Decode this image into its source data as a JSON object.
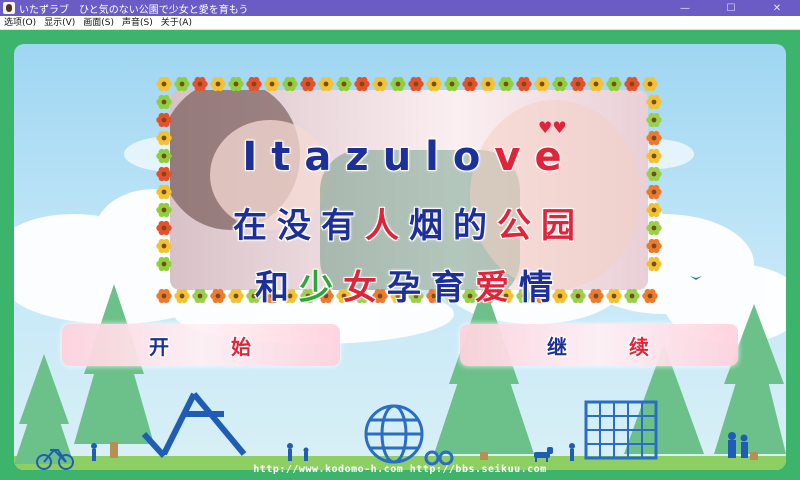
{
  "window": {
    "title": "いたずラブ　ひと気のない公園で少女と愛を育もう",
    "minimize": "—",
    "maximize": "☐",
    "close": "✕"
  },
  "menubar": {
    "items": [
      "选项(O)",
      "显示(V)",
      "画面(S)",
      "声音(S)",
      "关于(A)"
    ]
  },
  "title_logo": {
    "line1_part1": "Itazulo",
    "line1_part2": "ve",
    "hearts": "♥♥",
    "line2": [
      {
        "text": "在",
        "color": "blue"
      },
      {
        "text": "没",
        "color": "blue"
      },
      {
        "text": "有",
        "color": "blue"
      },
      {
        "text": "人",
        "color": "red"
      },
      {
        "text": "烟",
        "color": "blue"
      },
      {
        "text": "的",
        "color": "blue"
      },
      {
        "text": "公",
        "color": "red"
      },
      {
        "text": "园",
        "color": "red"
      }
    ],
    "line3": [
      {
        "text": "和",
        "color": "blue"
      },
      {
        "text": "少",
        "color": "green"
      },
      {
        "text": "女",
        "color": "red"
      },
      {
        "text": "孕",
        "color": "blue"
      },
      {
        "text": "育",
        "color": "blue"
      },
      {
        "text": "爱",
        "color": "red"
      },
      {
        "text": "情",
        "color": "blue"
      }
    ]
  },
  "buttons": {
    "start": {
      "char1": "开",
      "char2": "始"
    },
    "continue": {
      "char1": "继",
      "char2": "续"
    }
  },
  "footer": "http://www.kodomo-h.com  http://bbs.seikuu.com",
  "colors": {
    "title_bar": "#6a5cc4",
    "frame_green": "#3cb46c",
    "text_blue": "#1d2f9a",
    "text_red": "#e0243a",
    "text_green": "#2fa63a",
    "button_pink": "#ffd2de"
  }
}
